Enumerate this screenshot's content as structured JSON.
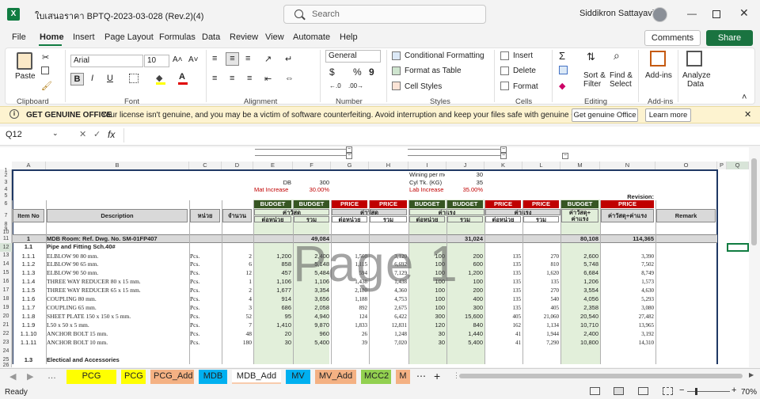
{
  "window": {
    "title": "ใบเสนอราคา BPTQ-2023-03-028 (Rev.2)(4)",
    "search_placeholder": "Search",
    "user": "Siddikron Sattayavinit"
  },
  "menu": {
    "tabs": [
      "File",
      "Home",
      "Insert",
      "Page Layout",
      "Formulas",
      "Data",
      "Review",
      "View",
      "Automate",
      "Help"
    ],
    "comments": "Comments",
    "share": "Share"
  },
  "ribbon": {
    "paste": "Paste",
    "clipboard": "Clipboard",
    "font_name": "Arial",
    "font_size": "10",
    "font": "Font",
    "alignment": "Alignment",
    "number_format": "General",
    "number": "Number",
    "cond_format": "Conditional Formatting",
    "format_table": "Format as Table",
    "cell_styles": "Cell Styles",
    "styles": "Styles",
    "insert": "Insert",
    "delete": "Delete",
    "format": "Format",
    "cells": "Cells",
    "sort_filter_1": "Sort &",
    "sort_filter_2": "Filter",
    "find_select_1": "Find &",
    "find_select_2": "Select",
    "editing": "Editing",
    "addin": "Add-ins",
    "addins": "Add-ins",
    "analyze_1": "Analyze",
    "analyze_2": "Data"
  },
  "license": {
    "title": "GET GENUINE OFFICE",
    "message": "Your license isn't genuine, and you may be a victim of software counterfeiting. Avoid interruption and keep your files safe with genuine Office today.",
    "btn_get": "Get genuine Office",
    "btn_learn": "Learn more"
  },
  "formula": {
    "cell": "Q12",
    "fx": "fx"
  },
  "columns": [
    "A",
    "B",
    "C",
    "D",
    "E",
    "F",
    "G",
    "H",
    "I",
    "J",
    "K",
    "L",
    "M",
    "N",
    "O",
    "P",
    "Q"
  ],
  "rows": [
    "1",
    "2",
    "3",
    "4",
    "5",
    "6",
    "7",
    "8",
    "9",
    "10",
    "11",
    "12",
    "13",
    "14",
    "15",
    "16",
    "17",
    "18",
    "19",
    "20",
    "21",
    "22",
    "23",
    "24",
    "25",
    "26"
  ],
  "sheet": {
    "wining": "Wining per meter",
    "wining_v": "30",
    "db": "DB",
    "db_v": "300",
    "cyl": "Cyl Tk. (KG)",
    "cyl_v": "35",
    "mat": "Mat Increase",
    "mat_v": "30.00%",
    "lab": "Lab Increase",
    "lab_v": "35.00%",
    "revision": "Revision:",
    "budget": "BUDGET",
    "price": "PRICE",
    "item_no": "Item No",
    "description": "Description",
    "unit": "หน่วย",
    "qty": "จำนวน",
    "material": "ค่าวัสดุ",
    "labour": "ค่าแรง",
    "per_unit": "ต่อหน่วย",
    "total": "รวม",
    "mat_plus_lab": "ค่าวัสดุ+ ค่าแรง",
    "mat_plus_lab2": "ค่าวัสดุ+ค่าแรง",
    "remark": "Remark",
    "watermark": "Page 1",
    "r11": {
      "no": "1",
      "desc": "MDB Room: Ref. Dwg. No. SM-01FP407",
      "f": "49,084",
      "j": "31,024",
      "m": "80,108",
      "n": "114,365"
    },
    "r12": {
      "no": "1.1",
      "desc": "Pipe and Fitting Sch.40#"
    },
    "items": [
      {
        "no": "1.1.1",
        "desc": "ELBLOW 90 80 mm.",
        "unit": "Pcs.",
        "qty": "2",
        "e": "1,200",
        "f": "2,400",
        "g": "1,560",
        "h": "3,120",
        "i": "100",
        "j": "200",
        "k": "135",
        "l": "270",
        "m": "2,600",
        "n": "3,390"
      },
      {
        "no": "1.1.2",
        "desc": "ELBLOW 90 65 mm.",
        "unit": "Pcs.",
        "qty": "6",
        "e": "858",
        "f": "5,148",
        "g": "1,115",
        "h": "6,692",
        "i": "100",
        "j": "600",
        "k": "135",
        "l": "810",
        "m": "5,748",
        "n": "7,502"
      },
      {
        "no": "1.1.3",
        "desc": "ELBLOW 90 50 mm.",
        "unit": "Pcs.",
        "qty": "12",
        "e": "457",
        "f": "5,484",
        "g": "594",
        "h": "7,129",
        "i": "100",
        "j": "1,200",
        "k": "135",
        "l": "1,620",
        "m": "6,684",
        "n": "8,749"
      },
      {
        "no": "1.1.4",
        "desc": "THREE WAY REDUCER 80 x 15 mm.",
        "unit": "Pcs.",
        "qty": "1",
        "e": "1,106",
        "f": "1,106",
        "g": "1,438",
        "h": "1,438",
        "i": "100",
        "j": "100",
        "k": "135",
        "l": "135",
        "m": "1,206",
        "n": "1,573"
      },
      {
        "no": "1.1.5",
        "desc": "THREE WAY REDUCER 65 x 15 mm.",
        "unit": "Pcs.",
        "qty": "2",
        "e": "1,677",
        "f": "3,354",
        "g": "2,180",
        "h": "4,360",
        "i": "100",
        "j": "200",
        "k": "135",
        "l": "270",
        "m": "3,554",
        "n": "4,630"
      },
      {
        "no": "1.1.6",
        "desc": "COUPLING 80 mm.",
        "unit": "Pcs.",
        "qty": "4",
        "e": "914",
        "f": "3,656",
        "g": "1,188",
        "h": "4,753",
        "i": "100",
        "j": "400",
        "k": "135",
        "l": "540",
        "m": "4,056",
        "n": "5,293"
      },
      {
        "no": "1.1.7",
        "desc": "COUPLING 65 mm.",
        "unit": "Pcs.",
        "qty": "3",
        "e": "686",
        "f": "2,058",
        "g": "892",
        "h": "2,675",
        "i": "100",
        "j": "300",
        "k": "135",
        "l": "405",
        "m": "2,358",
        "n": "3,080"
      },
      {
        "no": "1.1.8",
        "desc": "SHEET PLATE 150 x 150 x 5 mm.",
        "unit": "Pcs.",
        "qty": "52",
        "e": "95",
        "f": "4,940",
        "g": "124",
        "h": "6,422",
        "i": "300",
        "j": "15,600",
        "k": "405",
        "l": "21,060",
        "m": "20,540",
        "n": "27,482"
      },
      {
        "no": "1.1.9",
        "desc": "L50 x 50 x 5 mm.",
        "unit": "Pcs.",
        "qty": "7",
        "e": "1,410",
        "f": "9,870",
        "g": "1,833",
        "h": "12,831",
        "i": "120",
        "j": "840",
        "k": "162",
        "l": "1,134",
        "m": "10,710",
        "n": "13,965"
      },
      {
        "no": "1.1.10",
        "desc": "ANCHOR BOLT 15 mm.",
        "unit": "Pcs.",
        "qty": "48",
        "e": "20",
        "f": "960",
        "g": "26",
        "h": "1,248",
        "i": "30",
        "j": "1,440",
        "k": "41",
        "l": "1,944",
        "m": "2,400",
        "n": "3,192"
      },
      {
        "no": "1.1.11",
        "desc": "ANCHOR BOLT 10 mm.",
        "unit": "Pcs.",
        "qty": "180",
        "e": "30",
        "f": "5,400",
        "g": "39",
        "h": "7,020",
        "i": "30",
        "j": "5,400",
        "k": "41",
        "l": "7,290",
        "m": "10,800",
        "n": "14,310"
      }
    ],
    "r25": {
      "no": "1.3",
      "desc": "Electical and Accessories"
    }
  },
  "sheet_tabs": [
    {
      "label": "PCG (New)",
      "color": "#ffff00"
    },
    {
      "label": "PCG",
      "color": "#ffff00"
    },
    {
      "label": "PCG_Add",
      "color": "#f4b183"
    },
    {
      "label": "MDB",
      "color": "#00b0f0"
    },
    {
      "label": "MDB_Add",
      "color": "#f8cbad"
    },
    {
      "label": "MV",
      "color": "#00b0f0"
    },
    {
      "label": "MV_Add",
      "color": "#f4b183"
    },
    {
      "label": "MCC2",
      "color": "#92d050"
    },
    {
      "label": "M",
      "color": "#f4b183"
    }
  ],
  "status": {
    "ready": "Ready",
    "zoom": "70%"
  },
  "colors": {
    "excel_green": "#107c41",
    "budget_green": "#c6e0b4",
    "dark_header": "#244d1f",
    "price_red": "#c00000",
    "mat_red": "#c00000"
  }
}
